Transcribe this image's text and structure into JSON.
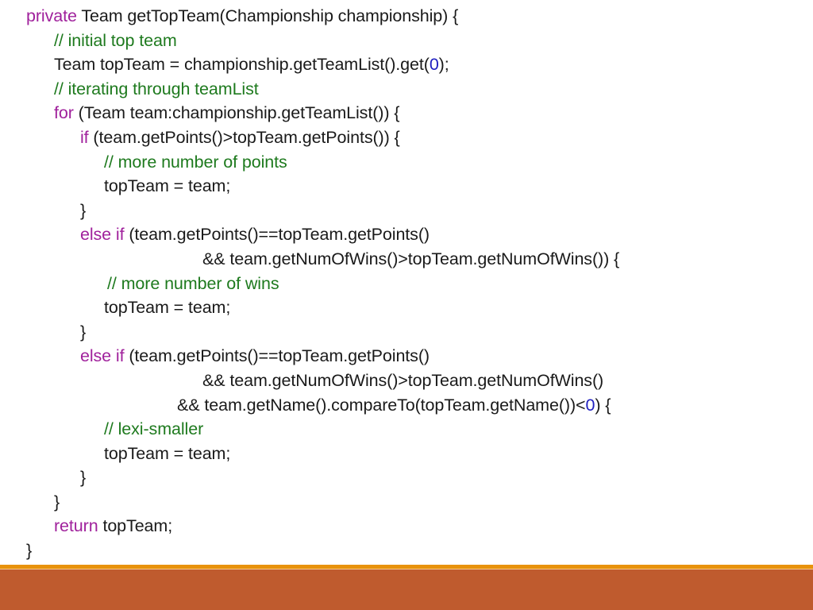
{
  "slide": {
    "background_color": "#ffffff",
    "language": "java"
  },
  "theme": {
    "text_color": "#1a1a1a",
    "keyword_color": "#A0219C",
    "comment_color": "#1E7A1E",
    "number_color": "#2020C0",
    "footer_stripe_color": "#E8920C",
    "footer_band_color": "#BF5B2E"
  },
  "code": {
    "lines": [
      {
        "id": "line-1",
        "indent": "ind-0",
        "tokens": [
          {
            "t": "private",
            "c": "kw"
          },
          {
            "t": " Team getTopTeam(Championship championship) {",
            "c": "plain"
          }
        ]
      },
      {
        "id": "line-2",
        "indent": "ind-1",
        "tokens": [
          {
            "t": "// initial top team",
            "c": "cmt"
          }
        ]
      },
      {
        "id": "line-3",
        "indent": "ind-1",
        "tokens": [
          {
            "t": "Team topTeam = championship.getTeamList().get(",
            "c": "plain"
          },
          {
            "t": "0",
            "c": "num"
          },
          {
            "t": ");",
            "c": "plain"
          }
        ]
      },
      {
        "id": "line-4",
        "indent": "ind-1",
        "tokens": [
          {
            "t": "// iterating through teamList",
            "c": "cmt"
          }
        ]
      },
      {
        "id": "line-5",
        "indent": "ind-1",
        "tokens": [
          {
            "t": "for",
            "c": "kw"
          },
          {
            "t": " (Team team:championship.getTeamList()) {",
            "c": "plain"
          }
        ]
      },
      {
        "id": "line-6",
        "indent": "ind-2",
        "tokens": [
          {
            "t": "if",
            "c": "kw"
          },
          {
            "t": " (team.getPoints()>topTeam.getPoints()) {",
            "c": "plain"
          }
        ]
      },
      {
        "id": "line-7",
        "indent": "ind-3",
        "tokens": [
          {
            "t": "// more number of points",
            "c": "cmt"
          }
        ]
      },
      {
        "id": "line-8",
        "indent": "ind-3",
        "tokens": [
          {
            "t": "topTeam = team;",
            "c": "plain"
          }
        ]
      },
      {
        "id": "line-9",
        "indent": "ind-2",
        "tokens": [
          {
            "t": "}",
            "c": "plain"
          }
        ]
      },
      {
        "id": "line-10",
        "indent": "ind-2",
        "tokens": [
          {
            "t": "else if",
            "c": "kw"
          },
          {
            "t": " (team.getPoints()==topTeam.getPoints()",
            "c": "plain"
          }
        ]
      },
      {
        "id": "line-11",
        "indent": "ind-cont-a",
        "tokens": [
          {
            "t": "&& team.getNumOfWins()>topTeam.getNumOfWins()) {",
            "c": "plain"
          }
        ]
      },
      {
        "id": "line-12",
        "indent": "ind-3b",
        "tokens": [
          {
            "t": "// more number of wins",
            "c": "cmt"
          }
        ]
      },
      {
        "id": "line-13",
        "indent": "ind-3",
        "tokens": [
          {
            "t": "topTeam = team;",
            "c": "plain"
          }
        ]
      },
      {
        "id": "line-14",
        "indent": "ind-2",
        "tokens": [
          {
            "t": "}",
            "c": "plain"
          }
        ]
      },
      {
        "id": "line-15",
        "indent": "ind-2",
        "tokens": [
          {
            "t": "else if",
            "c": "kw"
          },
          {
            "t": " (team.getPoints()==topTeam.getPoints()",
            "c": "plain"
          }
        ]
      },
      {
        "id": "line-16",
        "indent": "ind-cont-a",
        "tokens": [
          {
            "t": "&& team.getNumOfWins()>topTeam.getNumOfWins()",
            "c": "plain"
          }
        ]
      },
      {
        "id": "line-17",
        "indent": "ind-cont-b",
        "tokens": [
          {
            "t": "&& team.getName().compareTo(topTeam.getName())<",
            "c": "plain"
          },
          {
            "t": "0",
            "c": "num"
          },
          {
            "t": ") {",
            "c": "plain"
          }
        ]
      },
      {
        "id": "line-18",
        "indent": "ind-3",
        "tokens": [
          {
            "t": "// lexi-smaller",
            "c": "cmt"
          }
        ]
      },
      {
        "id": "line-19",
        "indent": "ind-3",
        "tokens": [
          {
            "t": "topTeam = team;",
            "c": "plain"
          }
        ]
      },
      {
        "id": "line-20",
        "indent": "ind-2",
        "tokens": [
          {
            "t": "}",
            "c": "plain"
          }
        ]
      },
      {
        "id": "line-21",
        "indent": "ind-1",
        "tokens": [
          {
            "t": "}",
            "c": "plain"
          }
        ]
      },
      {
        "id": "line-22",
        "indent": "ind-1",
        "tokens": [
          {
            "t": "return",
            "c": "kw"
          },
          {
            "t": " topTeam;",
            "c": "plain"
          }
        ]
      },
      {
        "id": "line-23",
        "indent": "ind-0",
        "tokens": [
          {
            "t": "}",
            "c": "plain"
          }
        ]
      }
    ]
  }
}
